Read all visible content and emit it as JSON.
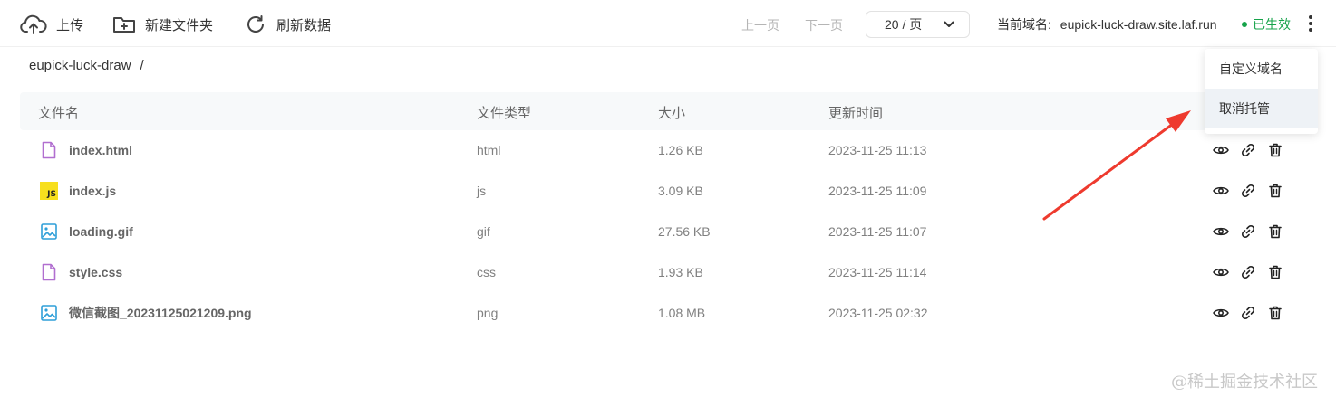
{
  "toolbar": {
    "upload_label": "上传",
    "new_folder_label": "新建文件夹",
    "refresh_label": "刷新数据",
    "prev_page_label": "上一页",
    "next_page_label": "下一页",
    "page_size_value": "20 / 页",
    "domain_label": "当前域名:",
    "domain_value": "eupick-luck-draw.site.laf.run",
    "status_text": "已生效",
    "status_color": "#16a34a"
  },
  "breadcrumb": {
    "bucket": "eupick-luck-draw",
    "separator": "/"
  },
  "table": {
    "columns": [
      "文件名",
      "文件类型",
      "大小",
      "更新时间"
    ],
    "rows": [
      {
        "name": "index.html",
        "type": "html",
        "size": "1.26 KB",
        "time": "2023-11-25 11:13",
        "icon": "file-icon"
      },
      {
        "name": "index.js",
        "type": "js",
        "size": "3.09 KB",
        "time": "2023-11-25 11:09",
        "icon": "js-icon",
        "badge": "JS"
      },
      {
        "name": "loading.gif",
        "type": "gif",
        "size": "27.56 KB",
        "time": "2023-11-25 11:07",
        "icon": "image-icon"
      },
      {
        "name": "style.css",
        "type": "css",
        "size": "1.93 KB",
        "time": "2023-11-25 11:14",
        "icon": "file-icon"
      },
      {
        "name": "微信截图_20231125021209.png",
        "type": "png",
        "size": "1.08 MB",
        "time": "2023-11-25 02:32",
        "icon": "image-icon"
      }
    ]
  },
  "dropdown": {
    "items": [
      "自定义域名",
      "取消托管"
    ]
  },
  "watermark": "@稀土掘金技术社区",
  "colors": {
    "accent": "#16a34a",
    "arrow": "#ee3a2e",
    "file_icon": "#b16fd0",
    "image_icon": "#2f9fd8"
  }
}
